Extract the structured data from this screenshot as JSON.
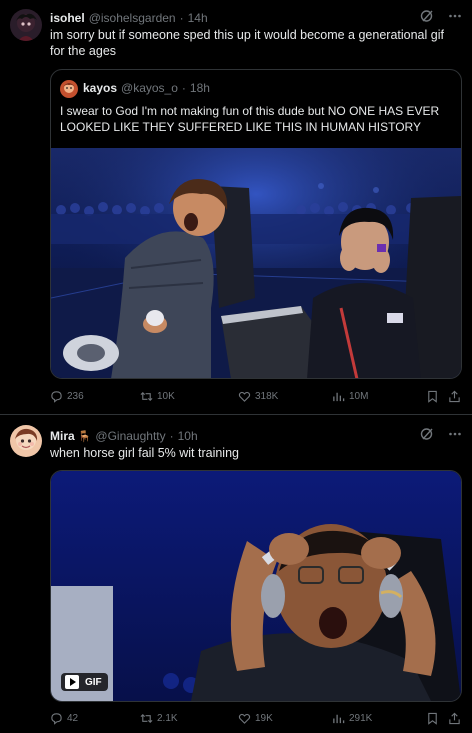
{
  "tweets": [
    {
      "name": "isohel",
      "handle": "@isohelsgarden",
      "dot": "·",
      "time": "14h",
      "text": "im sorry but if someone sped this up it would become a generational gif for the ages",
      "quote": {
        "name": "kayos",
        "handle": "@kayos_o",
        "dot": "·",
        "time": "18h",
        "text": "I swear to God I'm not making fun of this dude but NO ONE HAS EVER LOOKED LIKE THEY SUFFERED LIKE THIS IN HUMAN HISTORY"
      },
      "replies": "236",
      "retweets": "10K",
      "likes": "318K",
      "views": "10M"
    },
    {
      "name": "Mira",
      "emoji": "🪑",
      "handle": "@Ginaughtty",
      "dot": "·",
      "time": "10h",
      "text": "when horse girl fail 5% wit training",
      "gif_label": "GIF",
      "replies": "42",
      "retweets": "2.1K",
      "likes": "19K",
      "views": "291K"
    }
  ],
  "colors": {
    "background": "#000000",
    "text": "#e7e9ea",
    "muted": "#71767b",
    "border": "#2f3336"
  }
}
